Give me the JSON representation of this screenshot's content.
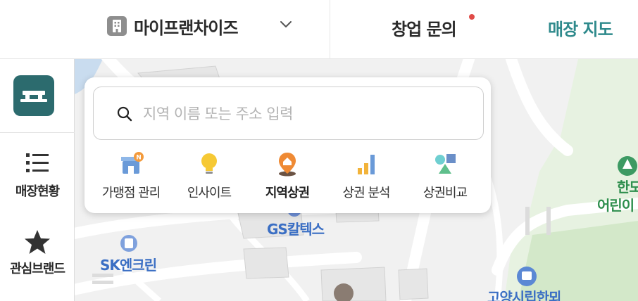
{
  "header": {
    "brand_name": "마이프랜차이즈",
    "nav_inquiry": "창업 문의",
    "nav_map": "매장 지도",
    "accent_color": "#2f8a8c",
    "notification_color": "#e04b47"
  },
  "sidebar": {
    "items": [
      {
        "label": "매장현황",
        "icon": "list-icon"
      },
      {
        "label": "관심브랜드",
        "icon": "star-icon"
      }
    ]
  },
  "search": {
    "placeholder": "지역 이름 또는 주소 입력",
    "value": ""
  },
  "menu": {
    "items": [
      {
        "label": "가맹점 관리",
        "icon": "store-icon",
        "badge": "N"
      },
      {
        "label": "인사이트",
        "icon": "lightbulb-icon"
      },
      {
        "label": "지역상권",
        "icon": "location-pin-icon",
        "active": true
      },
      {
        "label": "상권 분석",
        "icon": "bar-chart-icon"
      },
      {
        "label": "상권비교",
        "icon": "shapes-icon"
      }
    ]
  },
  "map": {
    "labels": {
      "gs": "GS칼텍스",
      "sk": "SK엔크린",
      "kindergarten_1": "한모",
      "kindergarten_2": "어린이",
      "library": "고양시립한뫼"
    }
  }
}
